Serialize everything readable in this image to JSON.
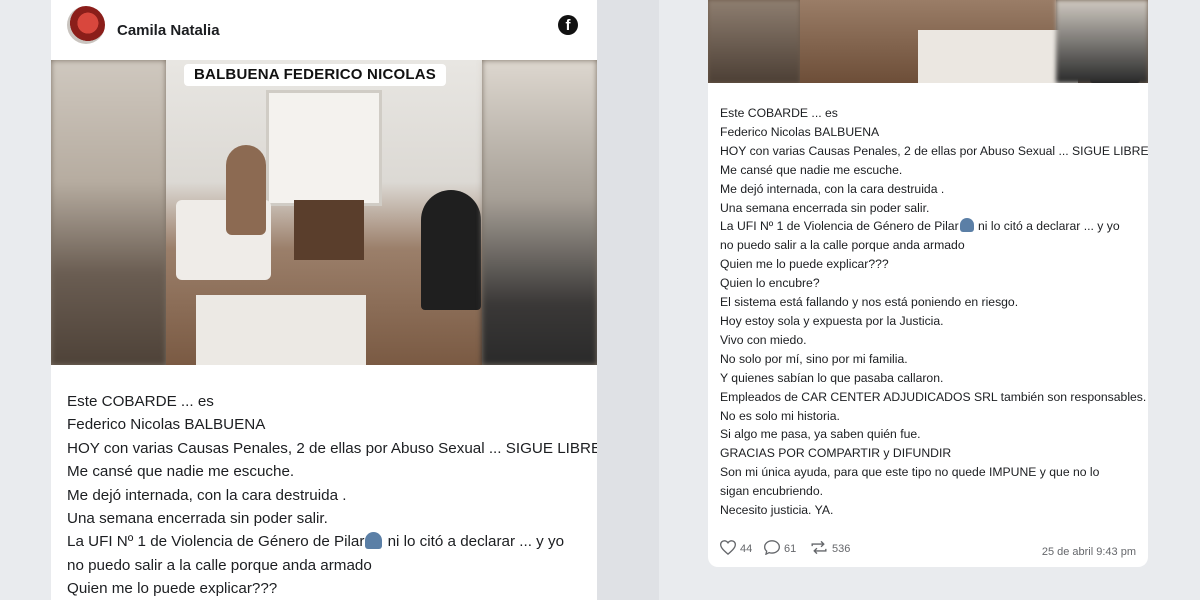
{
  "left_post": {
    "author": "Camila Natalia",
    "platform_icon": "facebook-icon",
    "photo_caption": "BALBUENA FEDERICO NICOLAS",
    "lines": [
      "Este COBARDE ... es",
      "Federico Nicolas BALBUENA",
      "HOY con varias Causas Penales, 2 de ellas por Abuso Sexual ... SIGUE LIBRE",
      "Me cansé que nadie me escuche.",
      "Me dejó internada, con la cara destruida .",
      "Una semana encerrada sin poder salir.",
      "La UFI Nº 1 de Violencia de Género de Pilar",
      " ni lo citó a declarar ... y yo",
      "no puedo salir a la calle porque anda armado",
      "Quien me lo puede explicar???"
    ]
  },
  "right_post": {
    "lines": [
      "Este COBARDE ... es",
      "Federico Nicolas BALBUENA",
      "HOY con varias Causas Penales, 2 de ellas por Abuso Sexual ... SIGUE LIBRE",
      "Me cansé que nadie me escuche.",
      "Me dejó internada, con la cara destruida .",
      "Una semana encerrada sin poder salir.",
      "La UFI Nº 1 de Violencia de Género de Pilar",
      " ni lo citó a declarar ... y yo",
      "no puedo salir a la calle porque anda armado",
      "Quien me lo puede explicar???",
      "Quien lo encubre?",
      "El sistema está fallando y nos está poniendo en riesgo.",
      "Hoy estoy sola y expuesta por la Justicia.",
      "Vivo con miedo.",
      "No solo por mí, sino por mi familia.",
      "Y quienes sabían lo que pasaba callaron.",
      "Empleados de CAR CENTER ADJUDICADOS SRL también son responsables.",
      "No es solo mi historia.",
      "Si algo me pasa, ya saben quién fue.",
      "GRACIAS POR COMPARTIR y DIFUNDIR",
      "Son mi única ayuda, para que este tipo no quede IMPUNE y que no lo",
      "sigan encubriendo.",
      "Necesito justicia. YA."
    ],
    "stats": {
      "likes": "44",
      "comments": "61",
      "shares": "536"
    },
    "timestamp": "25 de abril 9:43 pm"
  }
}
